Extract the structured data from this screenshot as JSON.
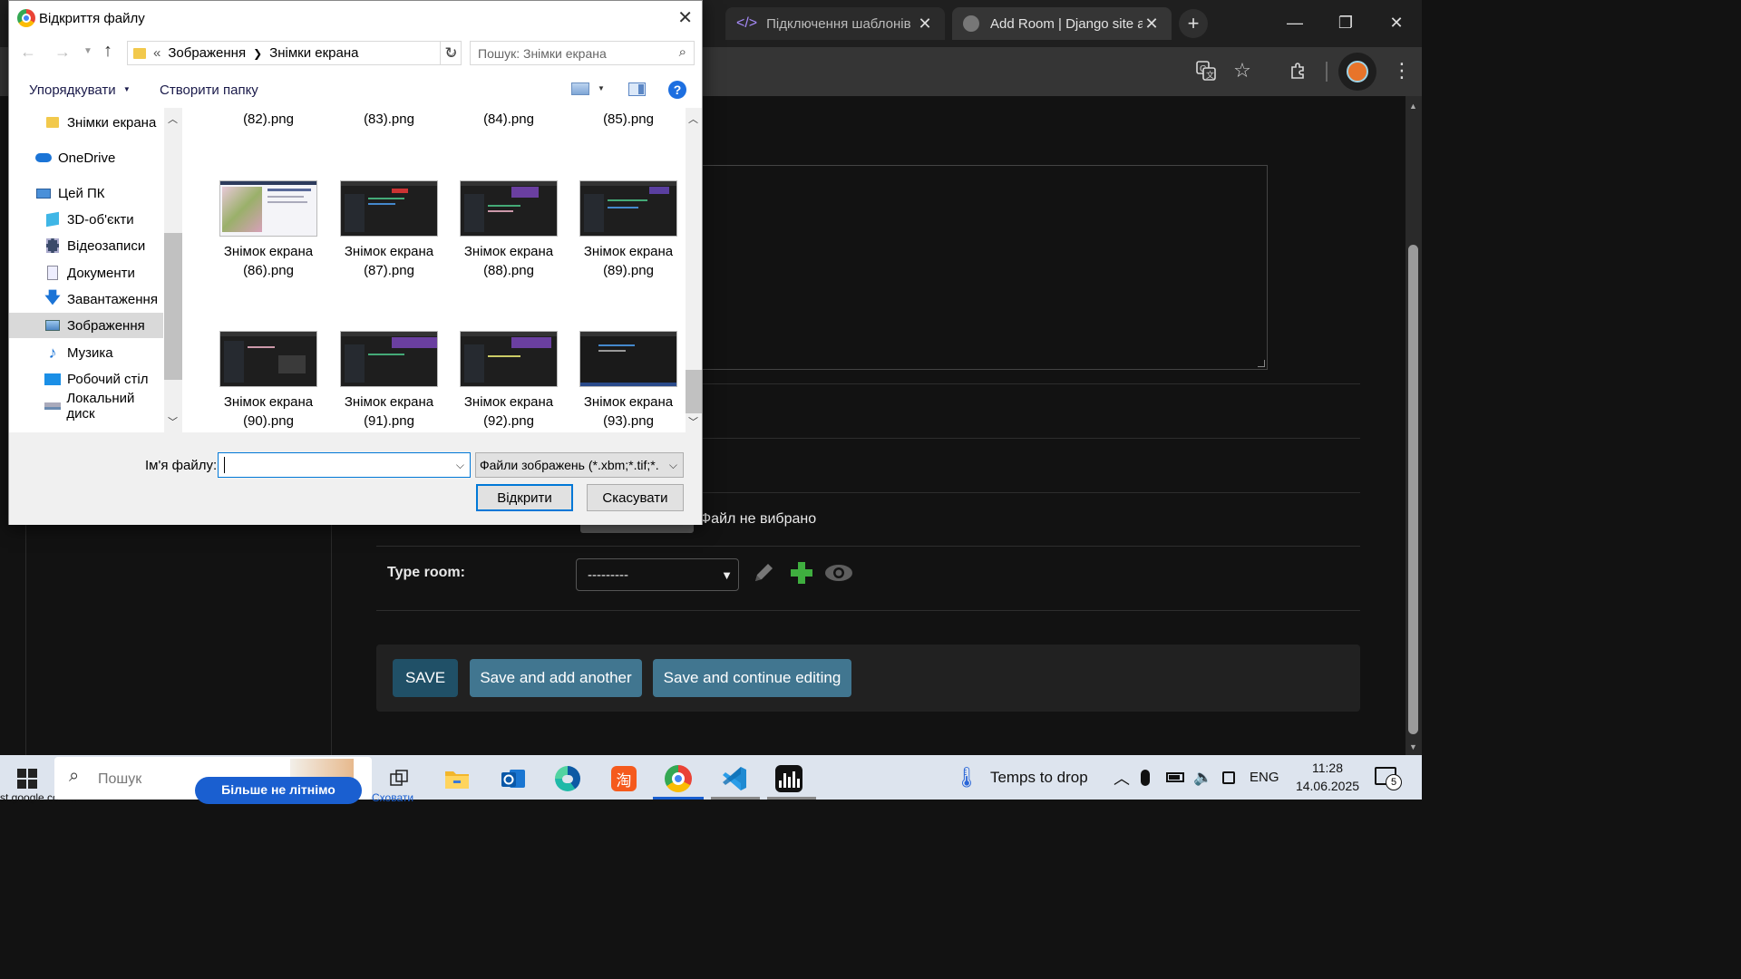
{
  "browser": {
    "tabs": [
      {
        "title": "Підключення шаблонів"
      },
      {
        "title": "Add Room | Django site admin"
      }
    ],
    "new_tab_symbol": "+",
    "icons": [
      "translate-icon",
      "star-icon",
      "extensions-icon",
      "profile-avatar",
      "menu-icon"
    ]
  },
  "dialog": {
    "title": "Відкриття файлу",
    "path": [
      "Зображення",
      "Знімки екрана"
    ],
    "path_prefix": "«",
    "search_placeholder": "Пошук: Знімки екрана",
    "organize": "Упорядкувати",
    "new_folder": "Створити папку",
    "nav_items": [
      {
        "label": "Знімки екрана",
        "icon": "folder-icon"
      },
      {
        "label": "OneDrive",
        "icon": "cloud-icon"
      },
      {
        "label": "Цей ПК",
        "icon": "pc-icon"
      },
      {
        "label": "3D-об'єкти",
        "icon": "cube-icon"
      },
      {
        "label": "Відеозаписи",
        "icon": "video-icon"
      },
      {
        "label": "Документи",
        "icon": "document-icon"
      },
      {
        "label": "Завантаження",
        "icon": "download-icon"
      },
      {
        "label": "Зображення",
        "icon": "pictures-icon",
        "selected": true
      },
      {
        "label": "Музика",
        "icon": "music-icon"
      },
      {
        "label": "Робочий стіл",
        "icon": "desktop-icon"
      },
      {
        "label": "Локальний диск",
        "icon": "disk-icon"
      }
    ],
    "top_row": [
      "(82).png",
      "(83).png",
      "(84).png",
      "(85).png"
    ],
    "files": [
      {
        "line1": "Знімок екрана",
        "line2": "(86).png"
      },
      {
        "line1": "Знімок екрана",
        "line2": "(87).png"
      },
      {
        "line1": "Знімок екрана",
        "line2": "(88).png"
      },
      {
        "line1": "Знімок екрана",
        "line2": "(89).png"
      },
      {
        "line1": "Знімок екрана",
        "line2": "(90).png"
      },
      {
        "line1": "Знімок екрана",
        "line2": "(91).png"
      },
      {
        "line1": "Знімок екрана",
        "line2": "(92).png"
      },
      {
        "line1": "Знімок екрана",
        "line2": "(93).png"
      }
    ],
    "filename_label": "Ім'я файлу:",
    "filename_value": "",
    "filetype": "Файли зображень (*.xbm;*.tif;*.",
    "open_button": "Відкрити",
    "cancel_button": "Скасувати"
  },
  "admin": {
    "no_file_text": "Файл не вибрано",
    "type_room_label": "Type room:",
    "type_room_value": "---------",
    "buttons": {
      "save": "SAVE",
      "save_add": "Save and add another",
      "save_continue": "Save and continue editing"
    }
  },
  "taskbar": {
    "search_text": "Пошук",
    "weather": "Temps to drop",
    "lang": "ENG",
    "time": "11:28",
    "date": "14.06.2025",
    "notifications": "5",
    "popup_fragment": "Більше не літнімо",
    "popup_link": "Сховати",
    "left_fragment": "st.google.com ...  "
  }
}
